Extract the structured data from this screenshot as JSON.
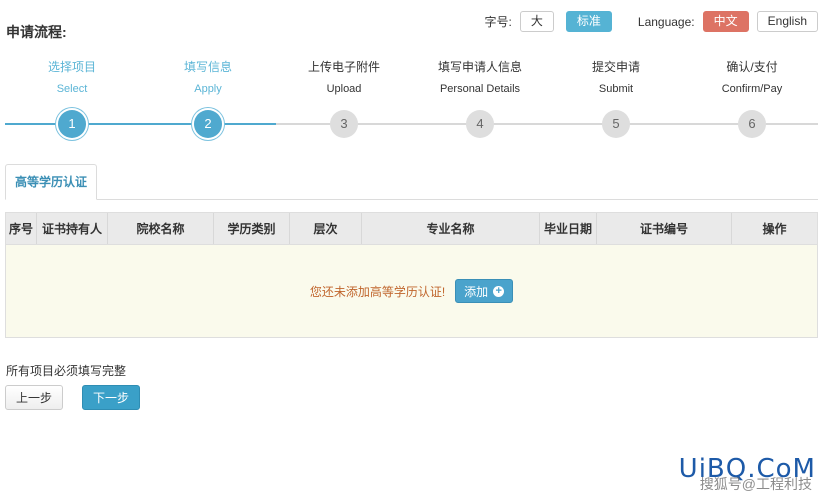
{
  "page": {
    "title": "申请流程:"
  },
  "toolbar": {
    "font_label": "字号:",
    "font_large": "大",
    "font_standard": "标准",
    "language_label": "Language:",
    "lang_cn": "中文",
    "lang_en": "English"
  },
  "steps": [
    {
      "cn": "选择项目",
      "en": "Select",
      "num": "1",
      "state": "done"
    },
    {
      "cn": "填写信息",
      "en": "Apply",
      "num": "2",
      "state": "done"
    },
    {
      "cn": "上传电子附件",
      "en": "Upload",
      "num": "3",
      "state": "todo"
    },
    {
      "cn": "填写申请人信息",
      "en": "Personal Details",
      "num": "4",
      "state": "todo"
    },
    {
      "cn": "提交申请",
      "en": "Submit",
      "num": "5",
      "state": "todo"
    },
    {
      "cn": "确认/支付",
      "en": "Confirm/Pay",
      "num": "6",
      "state": "todo"
    }
  ],
  "tab": {
    "label": "高等学历认证"
  },
  "table": {
    "columns": [
      "序号",
      "证书持有人",
      "院校名称",
      "学历类别",
      "层次",
      "专业名称",
      "毕业日期",
      "证书编号",
      "操作"
    ],
    "empty_message": "您还未添加高等学历认证!",
    "add_label": "添加"
  },
  "footer": {
    "hint": "所有项目必须填写完整",
    "prev": "上一步",
    "next": "下一步"
  },
  "watermark": {
    "brand": "UiBQ.CoM",
    "sub": "搜狐号@工程利技"
  },
  "colors": {
    "accent": "#4fa9cf",
    "lang_active": "#dd7364",
    "empty_text": "#c0652c",
    "empty_bg": "#fafaec"
  }
}
